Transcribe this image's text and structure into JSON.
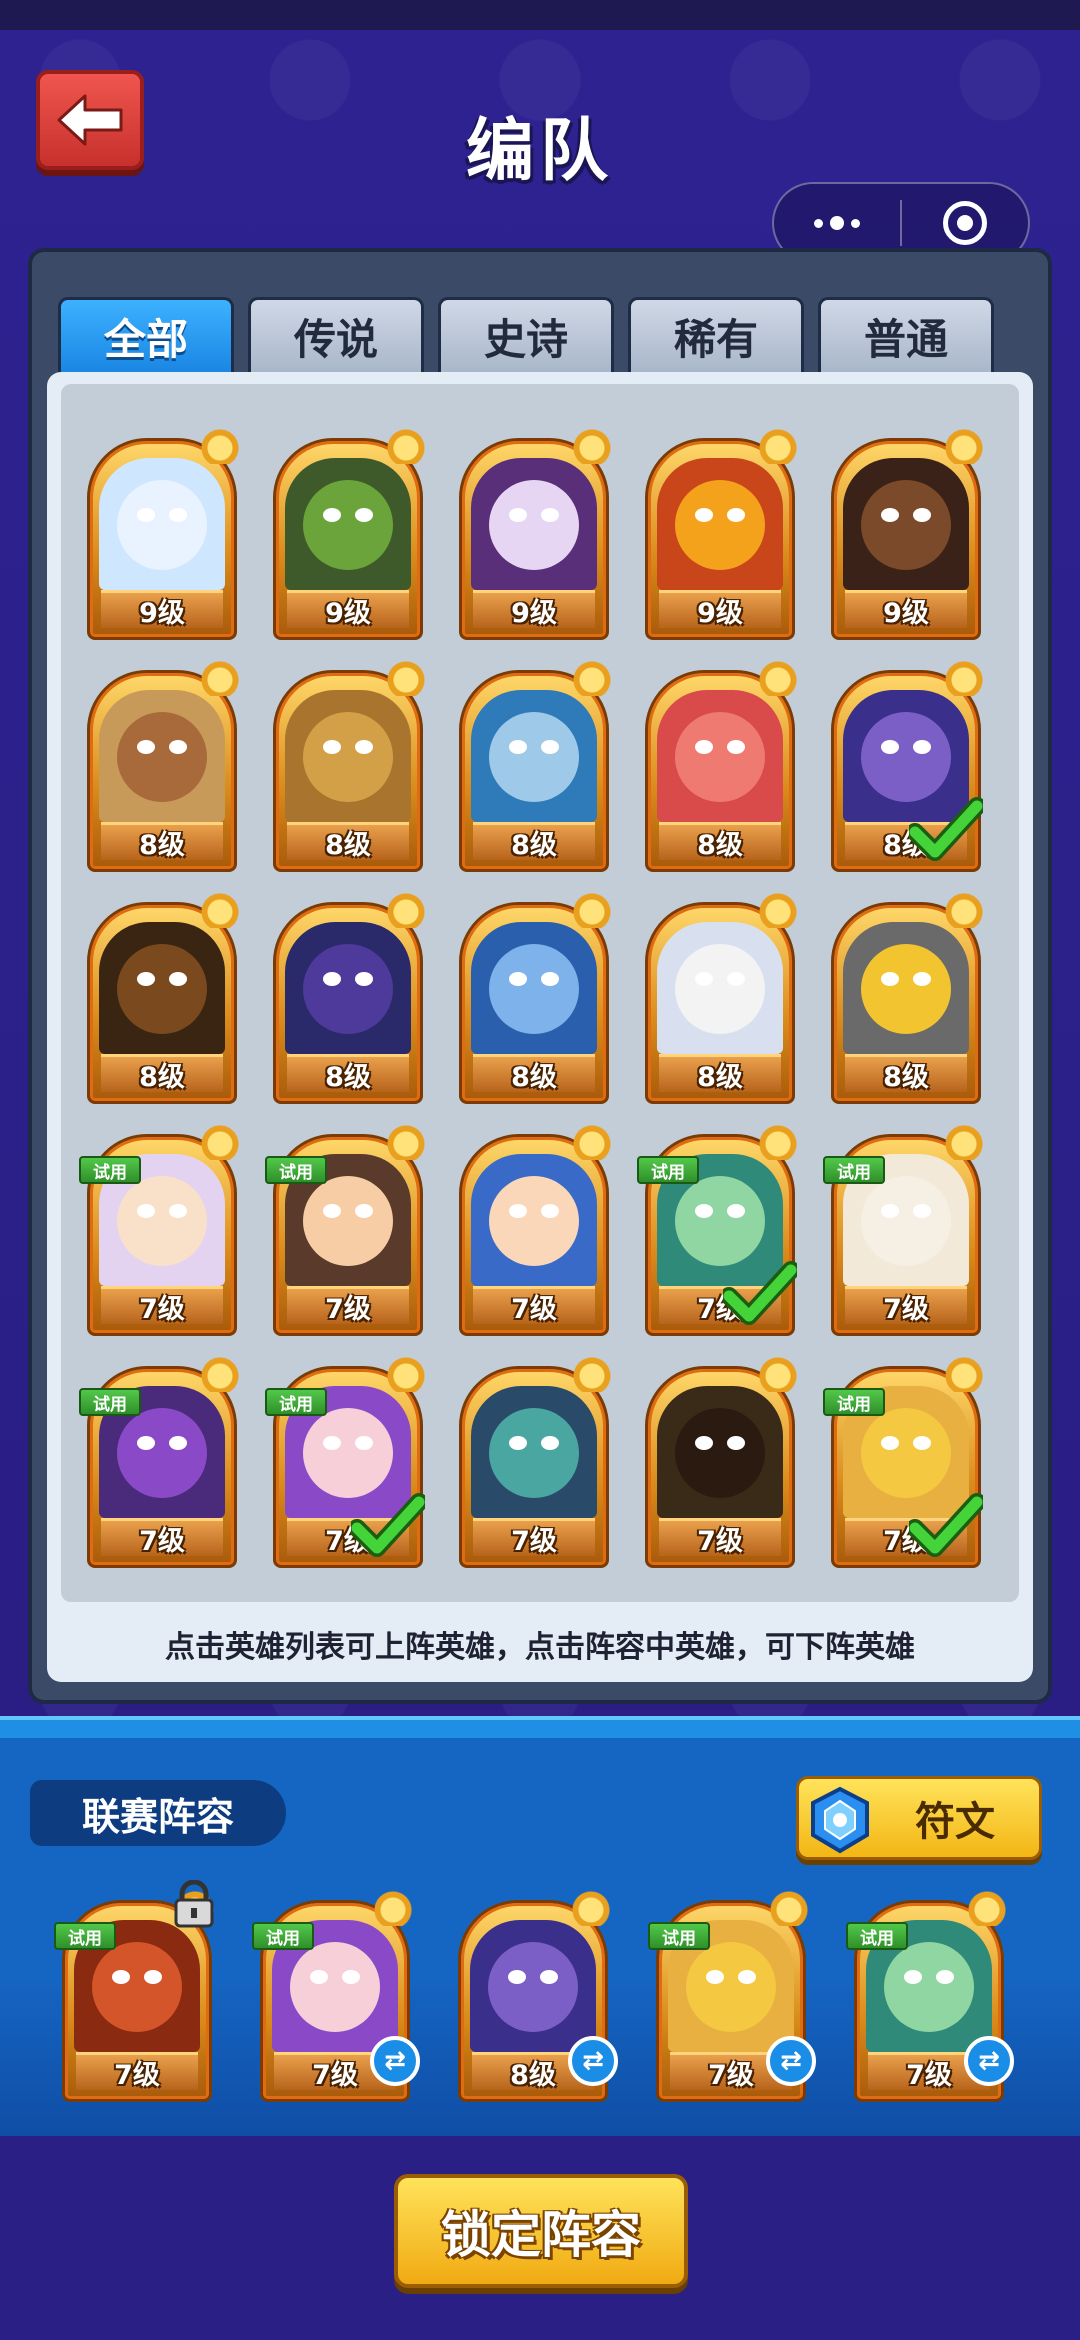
{
  "header": {
    "title": "编队"
  },
  "tabs": [
    {
      "label": "全部",
      "active": true
    },
    {
      "label": "传说",
      "active": false
    },
    {
      "label": "史诗",
      "active": false
    },
    {
      "label": "稀有",
      "active": false
    },
    {
      "label": "普通",
      "active": false
    }
  ],
  "heroes": [
    {
      "level": "9级",
      "color": "#cfe6ff",
      "face": "#e9f3ff",
      "trial": false,
      "selected": false
    },
    {
      "level": "9级",
      "color": "#3e5a2a",
      "face": "#6aa43a",
      "trial": false,
      "selected": false
    },
    {
      "level": "9级",
      "color": "#5a2f7a",
      "face": "#e7d6f3",
      "trial": false,
      "selected": false
    },
    {
      "level": "9级",
      "color": "#c8461a",
      "face": "#f4a21c",
      "trial": false,
      "selected": false
    },
    {
      "level": "9级",
      "color": "#3b2218",
      "face": "#7a4a2a",
      "trial": false,
      "selected": false
    },
    {
      "level": "8级",
      "color": "#c89a5a",
      "face": "#a86a3a",
      "trial": false,
      "selected": false
    },
    {
      "level": "8级",
      "color": "#a8742e",
      "face": "#d3a048",
      "trial": false,
      "selected": false
    },
    {
      "level": "8级",
      "color": "#2f7ab8",
      "face": "#9fc9e8",
      "trial": false,
      "selected": false
    },
    {
      "level": "8级",
      "color": "#d94a4a",
      "face": "#ef7a72",
      "trial": false,
      "selected": false
    },
    {
      "level": "8级",
      "color": "#3a2f8a",
      "face": "#7b5fc7",
      "trial": false,
      "selected": true
    },
    {
      "level": "8级",
      "color": "#3a2512",
      "face": "#7a4a1e",
      "trial": false,
      "selected": false
    },
    {
      "level": "8级",
      "color": "#2a2a6a",
      "face": "#4d3a9a",
      "trial": false,
      "selected": false
    },
    {
      "level": "8级",
      "color": "#2a5fae",
      "face": "#7db2ea",
      "trial": false,
      "selected": false
    },
    {
      "level": "8级",
      "color": "#d8e0f0",
      "face": "#f3f3f3",
      "trial": false,
      "selected": false
    },
    {
      "level": "8级",
      "color": "#6a6a6a",
      "face": "#f2c430",
      "trial": false,
      "selected": false
    },
    {
      "level": "7级",
      "color": "#e3d3f0",
      "face": "#f9e1c9",
      "trial": true,
      "selected": false
    },
    {
      "level": "7级",
      "color": "#5a3a2a",
      "face": "#f7cda6",
      "trial": true,
      "selected": false
    },
    {
      "level": "7级",
      "color": "#3a6ac8",
      "face": "#f9d7b8",
      "trial": false,
      "selected": false
    },
    {
      "level": "7级",
      "color": "#2f8a7a",
      "face": "#8fd6a2",
      "trial": true,
      "selected": true
    },
    {
      "level": "7级",
      "color": "#f3e9d8",
      "face": "#f6f0e4",
      "trial": true,
      "selected": false
    },
    {
      "level": "7级",
      "color": "#4a2a7a",
      "face": "#8a4ac8",
      "trial": true,
      "selected": false
    },
    {
      "level": "7级",
      "color": "#8a4ac8",
      "face": "#f6cfd8",
      "trial": true,
      "selected": true
    },
    {
      "level": "7级",
      "color": "#2a4a6a",
      "face": "#4aa6a0",
      "trial": false,
      "selected": false
    },
    {
      "level": "7级",
      "color": "#3a2a18",
      "face": "#2a1a10",
      "trial": false,
      "selected": false
    },
    {
      "level": "7级",
      "color": "#e8b040",
      "face": "#f4c840",
      "trial": true,
      "selected": true
    }
  ],
  "hint": "点击英雄列表可上阵英雄，点击阵容中英雄，可下阵英雄",
  "team": {
    "label": "联赛阵容",
    "rune_label": "符文",
    "trial_label": "试用",
    "members": [
      {
        "level": "7级",
        "color": "#8a2a10",
        "face": "#d5552a",
        "trial": true,
        "locked": true,
        "swap": false
      },
      {
        "level": "7级",
        "color": "#8a4ac8",
        "face": "#f6cfd8",
        "trial": true,
        "locked": false,
        "swap": true
      },
      {
        "level": "8级",
        "color": "#3a2f8a",
        "face": "#7b5fc7",
        "trial": false,
        "locked": false,
        "swap": true
      },
      {
        "level": "7级",
        "color": "#e8b040",
        "face": "#f4c840",
        "trial": true,
        "locked": false,
        "swap": true
      },
      {
        "level": "7级",
        "color": "#2f8a7a",
        "face": "#8fd6a2",
        "trial": true,
        "locked": false,
        "swap": true
      }
    ]
  },
  "lock_button": "锁定阵容",
  "colors": {
    "background": "#2b1f86",
    "tab_active": "#1a86e3",
    "trial_badge": "#2f8f2a",
    "check": "#37c23a"
  }
}
